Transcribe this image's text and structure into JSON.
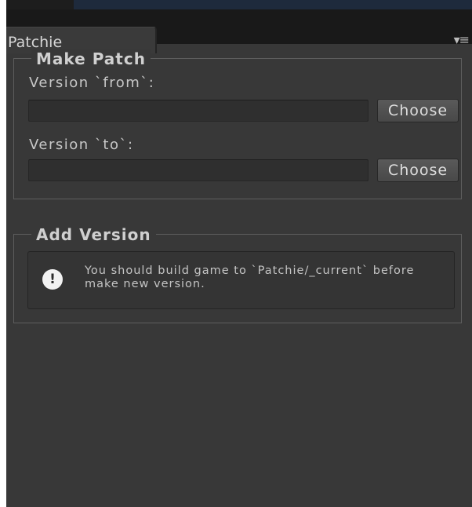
{
  "window": {
    "tab_title": "Patchie",
    "tab_menu_icon": "▾≡"
  },
  "make_patch": {
    "title": "Make Patch",
    "from_label": "Version `from`:",
    "from_value": "",
    "to_label": "Version `to`:",
    "to_value": "",
    "choose_label": "Choose"
  },
  "add_version": {
    "title": "Add Version",
    "info_icon": "!",
    "help_message": "You should build game to `Patchie/_current` before make new version."
  }
}
